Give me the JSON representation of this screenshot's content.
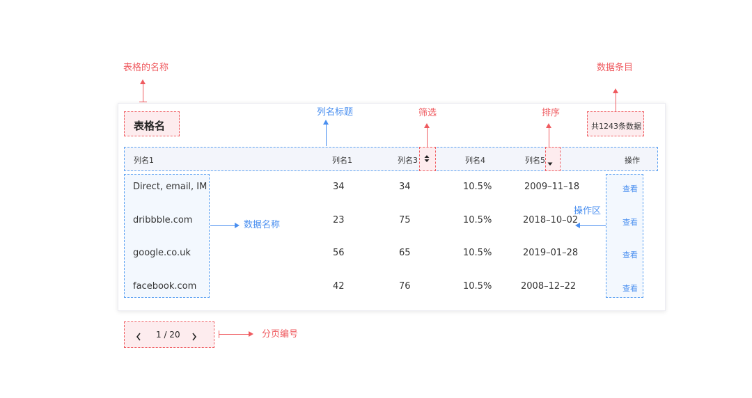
{
  "annotations": {
    "table_name": "表格的名称",
    "data_count": "数据条目",
    "column_title": "列名标题",
    "filter": "筛选",
    "sort": "排序",
    "data_name": "数据名称",
    "operation_area": "操作区",
    "pagination": "分页编号"
  },
  "table": {
    "title": "表格名",
    "count_text": "共1243条数据",
    "columns": [
      "列名1",
      "列名1",
      "列名3",
      "列名4",
      "列名5",
      "操作"
    ],
    "rows": [
      {
        "name": "Direct, email, IM",
        "c1": "34",
        "c2": "34",
        "c3": "10.5%",
        "date": "2009–11–18",
        "action": "查看"
      },
      {
        "name": "dribbble.com",
        "c1": "23",
        "c2": "75",
        "c3": "10.5%",
        "date": "2018–10–02",
        "action": "查看"
      },
      {
        "name": "google.co.uk",
        "c1": "56",
        "c2": "65",
        "c3": "10.5%",
        "date": "2019–01–28",
        "action": "查看"
      },
      {
        "name": "facebook.com",
        "c1": "42",
        "c2": "76",
        "c3": "10.5%",
        "date": "2008–12–22",
        "action": "查看"
      }
    ]
  },
  "pagination": {
    "prev_icon": "chevron-left-icon",
    "next_icon": "chevron-right-icon",
    "page_text": "1 / 20"
  },
  "colors": {
    "annotation_red": "#ef5a5f",
    "annotation_blue": "#4a8ff0",
    "link": "#4a8ff0"
  }
}
